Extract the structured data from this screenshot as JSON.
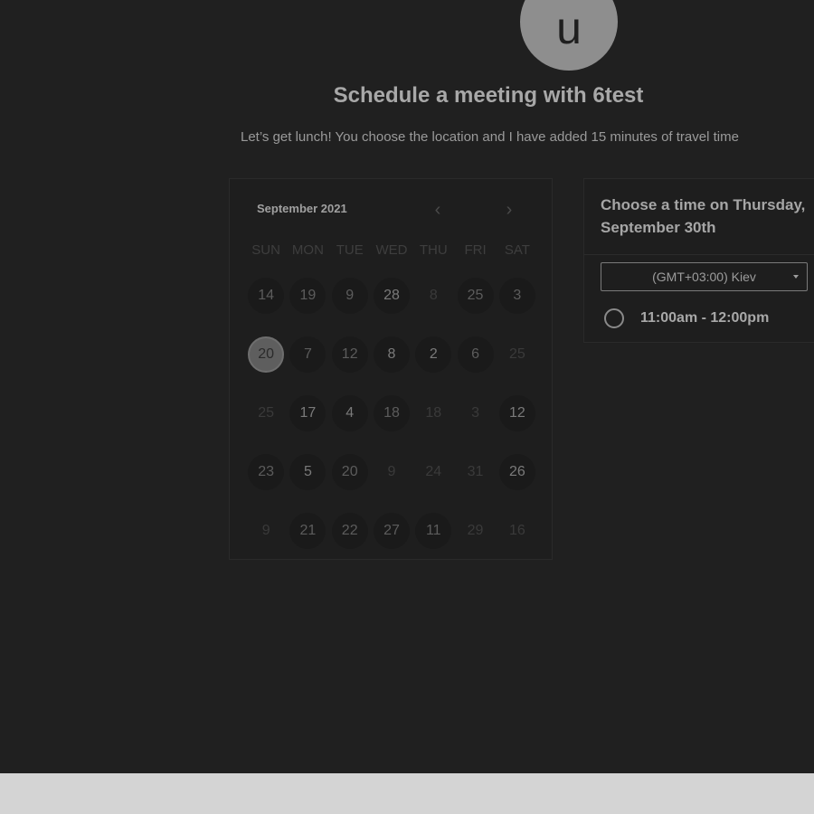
{
  "avatar": {
    "initial": "u"
  },
  "header": {
    "title": "Schedule a meeting with 6test",
    "description": "Let’s get lunch! You choose the location and I have added 15 minutes of travel time"
  },
  "calendar": {
    "month_label": "September 2021",
    "prev_icon": "chevron-left-icon",
    "next_icon": "chevron-right-icon",
    "prev_glyph": "‹",
    "next_glyph": "›",
    "weekdays": [
      "SUN",
      "MON",
      "TUE",
      "WED",
      "THU",
      "FRI",
      "SAT"
    ],
    "weeks": [
      [
        {
          "label": "14",
          "state": "avail"
        },
        {
          "label": "19",
          "state": "avail"
        },
        {
          "label": "9",
          "state": "avail"
        },
        {
          "label": "28",
          "state": "avail lighter"
        },
        {
          "label": "8",
          "state": "unavail"
        },
        {
          "label": "25",
          "state": "avail"
        },
        {
          "label": "3",
          "state": "avail"
        }
      ],
      [
        {
          "label": "20",
          "state": "selected"
        },
        {
          "label": "7",
          "state": "avail"
        },
        {
          "label": "12",
          "state": "avail"
        },
        {
          "label": "8",
          "state": "avail lighter"
        },
        {
          "label": "2",
          "state": "avail lighter"
        },
        {
          "label": "6",
          "state": "avail"
        },
        {
          "label": "25",
          "state": "unavail"
        }
      ],
      [
        {
          "label": "25",
          "state": "unavail"
        },
        {
          "label": "17",
          "state": "avail lighter"
        },
        {
          "label": "4",
          "state": "avail lighter"
        },
        {
          "label": "18",
          "state": "avail"
        },
        {
          "label": "18",
          "state": "unavail"
        },
        {
          "label": "3",
          "state": "unavail"
        },
        {
          "label": "12",
          "state": "avail lighter"
        }
      ],
      [
        {
          "label": "23",
          "state": "avail"
        },
        {
          "label": "5",
          "state": "avail lighter"
        },
        {
          "label": "20",
          "state": "avail"
        },
        {
          "label": "9",
          "state": "unavail"
        },
        {
          "label": "24",
          "state": "unavail"
        },
        {
          "label": "31",
          "state": "unavail"
        },
        {
          "label": "26",
          "state": "avail lighter"
        }
      ],
      [
        {
          "label": "9",
          "state": "unavail"
        },
        {
          "label": "21",
          "state": "avail"
        },
        {
          "label": "22",
          "state": "avail"
        },
        {
          "label": "27",
          "state": "avail"
        },
        {
          "label": "11",
          "state": "avail"
        },
        {
          "label": "29",
          "state": "unavail"
        },
        {
          "label": "16",
          "state": "unavail"
        }
      ]
    ]
  },
  "time_panel": {
    "heading_line1": "Choose a time on Thursday,",
    "heading_line2": "September 30th",
    "timezone": "(GMT+03:00) Kiev",
    "slots": [
      {
        "label": "11:00am - 12:00pm"
      }
    ]
  },
  "colors": {
    "background": "#202020",
    "footer": "#d4d4d4",
    "selected_day": "#5e5e5e"
  }
}
